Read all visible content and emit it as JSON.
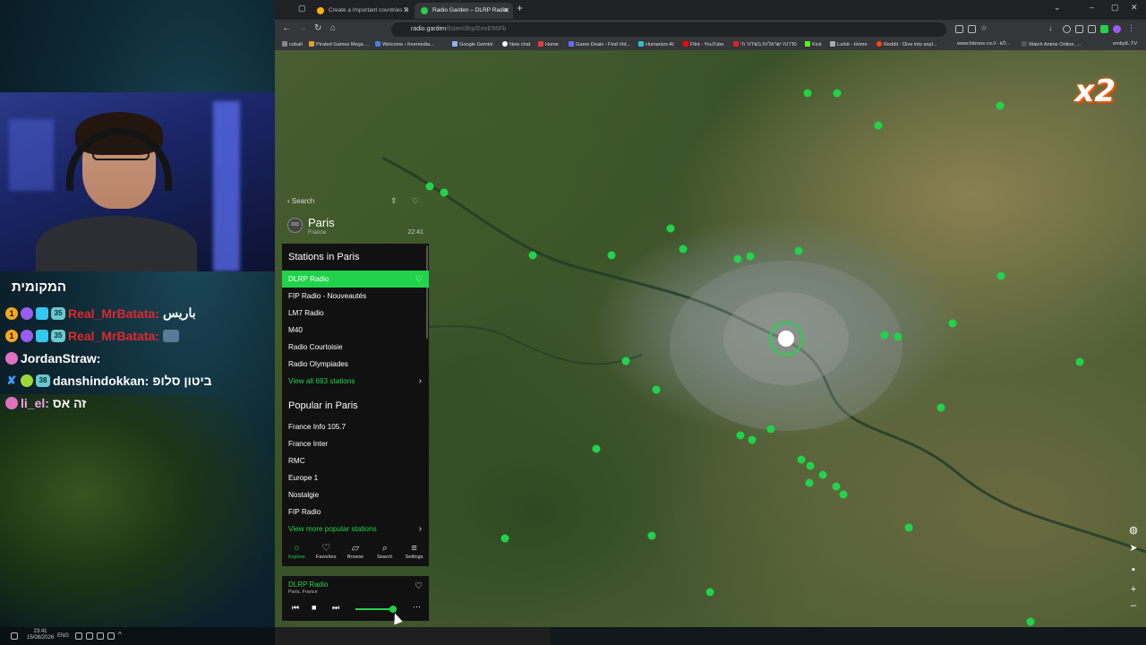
{
  "browser": {
    "tabs": [
      {
        "label": "Create a Important countries Ti"
      },
      {
        "label": "Radio Garden – DLRP Radio"
      }
    ],
    "url_host": "radio.garden",
    "url_path": "/listen/dlrp/EeeE56Fb",
    "bookmarks": [
      "cobalt",
      "Pirated Games Mega ...",
      "Welcome › freemedia...",
      "Google Gemini",
      "New chat",
      "Home",
      "Game Deals - Find Vid...",
      "Humanize AI",
      "Flint - YouTube",
      "סדרות ישראליות בשידור חי",
      "Kick",
      "Lurkit - Home",
      "Reddit - Dive into anyt...",
      "www.hitzone.co.il - לש...",
      "Watch Anime Online, ...",
      "embyIL.TV"
    ]
  },
  "chat": {
    "title": "המקומית",
    "messages": [
      {
        "user": "Real_MrBatata:",
        "text": "باريس",
        "badges": [
          "1",
          "",
          "",
          "35"
        ],
        "color": "red"
      },
      {
        "user": "Real_MrBatata:",
        "text": "",
        "badges": [
          "1",
          "",
          "",
          "35"
        ],
        "color": "red"
      },
      {
        "user": "JordanStraw:",
        "text": "",
        "badges": [
          ""
        ],
        "color": "purple"
      },
      {
        "user": "danshindokkan:",
        "text": "ביטון סלופ",
        "badges": [
          "",
          "",
          "38"
        ],
        "color": "white"
      },
      {
        "user": "li_el:",
        "text": "זה אס",
        "badges": [
          ""
        ],
        "color": "pink"
      }
    ]
  },
  "taskbar": {
    "time": "23:41",
    "date": "15/08/2026",
    "lang": "ENG"
  },
  "overlay": {
    "logo": "x2"
  },
  "panel": {
    "back_label": "Search",
    "place_badge": "693",
    "place_name": "Paris",
    "place_country": "France",
    "local_time": "22:41",
    "stations_title": "Stations in Paris",
    "stations": [
      "DLRP Radio",
      "FIP Radio - Nouveautés",
      "LM7 Radio",
      "M40",
      "Radio Courtoisie",
      "Radio Olympiades"
    ],
    "view_all": "View all 693 stations",
    "popular_title": "Popular in Paris",
    "popular": [
      "France Info 105.7",
      "France Inter",
      "RMC",
      "Europe 1",
      "Nostalgie",
      "FIP Radio"
    ],
    "view_more": "View more popular stations"
  },
  "nav": [
    {
      "label": "Explore",
      "icon": "explore-icon"
    },
    {
      "label": "Favorites",
      "icon": "heart-icon"
    },
    {
      "label": "Browse",
      "icon": "map-icon"
    },
    {
      "label": "Search",
      "icon": "search-icon"
    },
    {
      "label": "Settings",
      "icon": "settings-icon"
    }
  ],
  "player": {
    "station": "DLRP Radio",
    "location": "Paris, France",
    "volume": 0.92
  },
  "colors": {
    "accent": "#21d34b",
    "panel_bg": "#111111"
  }
}
